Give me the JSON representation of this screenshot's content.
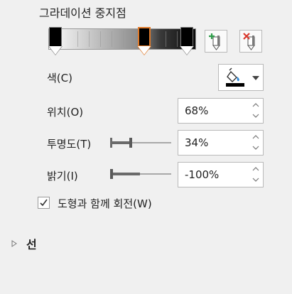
{
  "section": {
    "title": "그라데이션 중지점"
  },
  "gradient": {
    "stops_count": 3,
    "selected_stop": 2,
    "stop_positions_percent": [
      0,
      68,
      100
    ],
    "add_stop_tooltip_icon": "add-gradient-stop-icon",
    "remove_stop_tooltip_icon": "remove-gradient-stop-icon"
  },
  "color": {
    "label": "색(C)",
    "current": "#000000",
    "icon": "paint-bucket-icon"
  },
  "position": {
    "label": "위치(O)",
    "value": "68%"
  },
  "transparency": {
    "label": "투명도(T)",
    "value": "34%",
    "slider_fraction": 0.34
  },
  "brightness": {
    "label": "밝기(I)",
    "value": "-100%",
    "slider_fraction": 0.0
  },
  "rotate_with_shape": {
    "label": "도형과 함께 회전(W)",
    "checked": true
  },
  "line_section": {
    "label": "선",
    "expanded": false
  },
  "colors": {
    "selected_stop_border": "#e07a2a",
    "add_icon_green": "#2e9e4a",
    "remove_icon_red": "#d9362b"
  }
}
